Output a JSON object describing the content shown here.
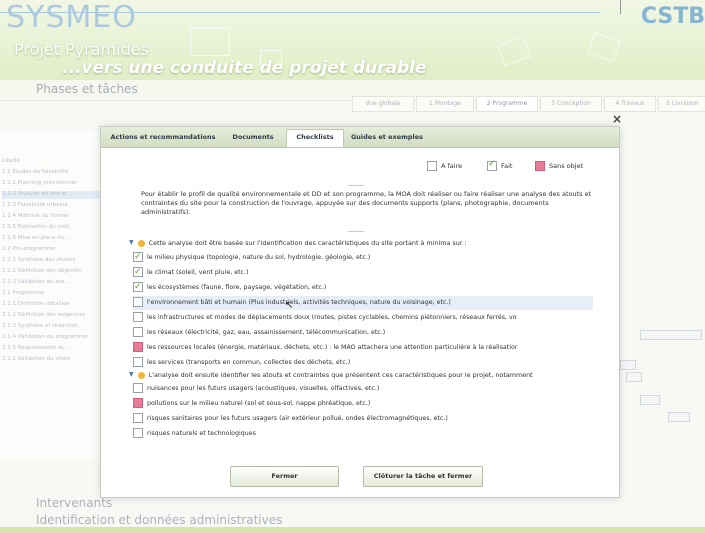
{
  "app": {
    "logo": "SYSMEO",
    "logo_right": "CSTB",
    "project_title": "Projet  Pyramides",
    "project_subtitle": "...vers une conduite de projet durable",
    "phases_title": "Phases et tâches"
  },
  "phase_tabs": [
    {
      "label": "Vue globale"
    },
    {
      "label": "1 Montage"
    },
    {
      "label": "2 Programme"
    },
    {
      "label": "3 Conception"
    },
    {
      "label": "4 Travaux"
    },
    {
      "label": "5 Livraison"
    }
  ],
  "bg_tasks": [
    "Libellé",
    "1.1 Études de faisabilité",
    "1.1.1 Planning prévisionnel",
    "1.1.2 Analyse du site et...",
    "1.1.3 Faisabilité urbaine",
    "1.1.4 Maîtrise du foncier",
    "1.1.5 Estimation du coût",
    "1.1.6 Mise en place du...",
    "1.2 Pré-programme",
    "1.2.1 Synthèse des études",
    "1.2.2 Définition des objectifs",
    "1.2.3 Validation du pré...",
    "2.1 Programme",
    "2.1.1 Définition détaillée",
    "2.1.2 Définition des exigences",
    "2.1.3 Synthèse et rédaction",
    "2.1.4 Validation du programme",
    "2.1.5 Réajustement du...",
    "2.2.1 Validation du choix"
  ],
  "bottom": {
    "intervenants": "Intervenants",
    "identification": "Identification et données administratives"
  },
  "dialog": {
    "close": "×",
    "tabs": [
      {
        "label": "Actions et recommandations"
      },
      {
        "label": "Documents"
      },
      {
        "label": "Checklists"
      },
      {
        "label": "Guides et exemples"
      }
    ],
    "legend": {
      "todo": "A faire",
      "done": "Fait",
      "na": "Sans objet"
    },
    "intro": "Pour établir le profil de qualité environnementale et DD et son programme, la MOA doit réaliser ou faire réaliser une analyse des atouts et contraintes du site pour la construction de l'ouvrage, appuyée sur des documents supports (plans, photographie, documents administratifs).",
    "group1": "Cette analyse doit être basée sur l'identification des caractéristiques du site portant à minima sur :",
    "group1_items": [
      {
        "label": "le milieu physique (topologie, nature du sol, hydrologie, géologie, etc.)",
        "status": "done"
      },
      {
        "label": "le climat (soleil, vent pluie, etc.)",
        "status": "done"
      },
      {
        "label": "les écosystèmes (faune, flore, paysage, végétation, etc.)",
        "status": "done"
      },
      {
        "label": "l'environnement bâti et humain (Plus industriels, activités techniques, nature du voisinage, etc.)",
        "status": "todo"
      },
      {
        "label": "les infrastructures et modes de déplacements doux (routes, pistes cyclables, chemins piétonniers, réseaux ferrés, vo",
        "status": "todo"
      },
      {
        "label": "les réseaux (électricité, gaz, eau, assainissement, télécommunication, etc.)",
        "status": "todo"
      },
      {
        "label": "les ressources locales (énergie, matériaux, déchets, etc.) : le MAO attachera une attention particulière à la réalisatior",
        "status": "na"
      },
      {
        "label": "les services (transports en commun, collectes des déchets, etc.)",
        "status": "todo"
      }
    ],
    "group2": "L'analyse doit ensuite identifier les atouts et contraintes que présentent ces  caractéristiques pour le projet, notamment",
    "group2_items": [
      {
        "label": "nuisances pour les futurs usagers (acoustiques, visuelles, olfactives, etc.)",
        "status": "todo"
      },
      {
        "label": "pollutions sur le milieu naturel (sol et sous-sol, nappe phréatique, etc.)",
        "status": "na"
      },
      {
        "label": "risques sanitaires pour les futurs usagers (air extérieur pollué, ondes électromagnétiques, etc.)",
        "status": "todo"
      },
      {
        "label": "risques naturels et technologiques",
        "status": "todo"
      }
    ],
    "buttons": {
      "close": "Fermer",
      "close_task": "Clôturer la tâche et fermer"
    }
  },
  "colors": {
    "header_green": "#cfe3a4",
    "checkbox_done": "#58a12d",
    "checkbox_na": "#e57b95",
    "selected_row": "#e6eef8"
  }
}
